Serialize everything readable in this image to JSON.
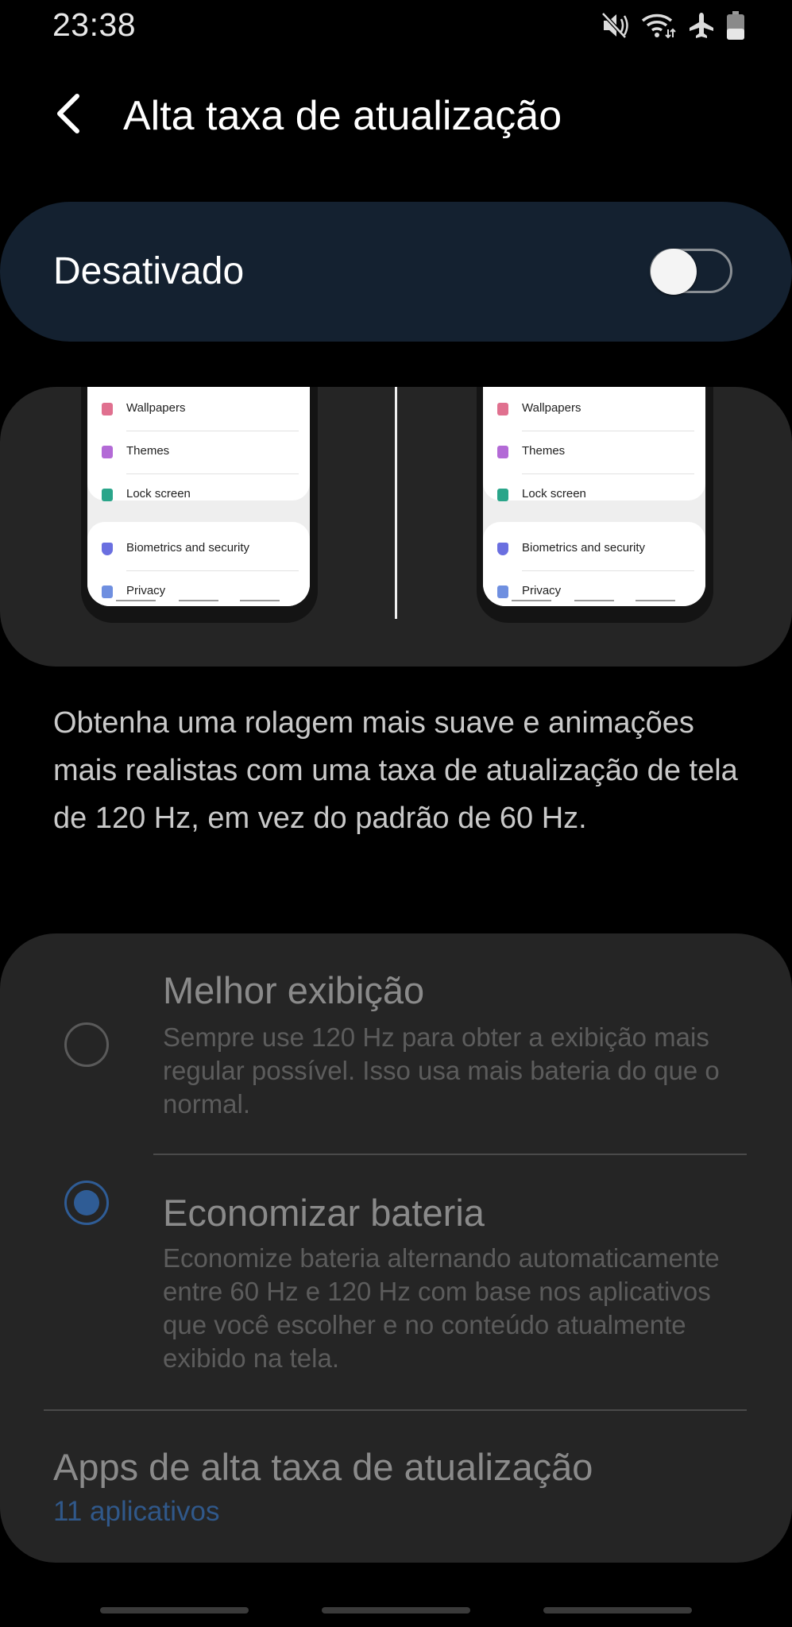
{
  "status_bar": {
    "time": "23:38",
    "icons": [
      "mute-icon",
      "wifi-icon",
      "airplane-icon",
      "battery-icon"
    ]
  },
  "header": {
    "back_icon": "chevron-left-icon",
    "title": "Alta taxa de atualização"
  },
  "toggle": {
    "label": "Desativado",
    "checked": false
  },
  "preview": {
    "menu_items_group1": [
      {
        "label": "Wallpapers",
        "icon": "wallpaper-icon",
        "color": "#e0708f"
      },
      {
        "label": "Themes",
        "icon": "themes-icon",
        "color": "#b36ad6"
      },
      {
        "label": "Lock screen",
        "icon": "lock-icon",
        "color": "#2aa58a"
      }
    ],
    "menu_items_group2": [
      {
        "label": "Biometrics and security",
        "icon": "shield-icon",
        "color": "#6a6fe0"
      },
      {
        "label": "Privacy",
        "icon": "privacy-icon",
        "color": "#6f8fe0"
      }
    ]
  },
  "description": "Obtenha uma rolagem mais suave e animações mais realistas com uma taxa de atualização de tela de 120 Hz, em vez do padrão de 60 Hz.",
  "options": [
    {
      "title": "Melhor exibição",
      "description": "Sempre use 120 Hz para obter a exibição mais regular possível. Isso usa mais bateria do que o normal.",
      "selected": false
    },
    {
      "title": "Economizar bateria",
      "description": "Economize bateria alternando automaticamente entre 60 Hz e 120 Hz com base nos aplicativos que você escolher e no conteúdo atualmente exibido na tela.",
      "selected": true
    }
  ],
  "apps": {
    "title": "Apps de alta taxa de atualização",
    "count": "11 aplicativos"
  },
  "colors": {
    "accent": "#2f5c95",
    "toggle_card": "#142130",
    "card": "#252525",
    "background": "#000000"
  }
}
